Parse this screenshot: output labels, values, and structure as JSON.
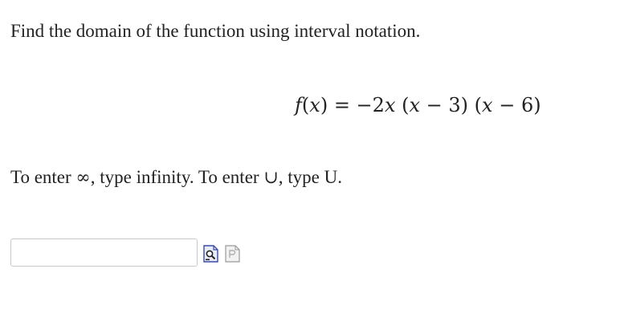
{
  "question": {
    "text": "Find the domain of the function using interval notation."
  },
  "equation": {
    "f": "f",
    "lparen1": "(",
    "x1": "x",
    "rparen1": ")",
    "equals": " = −2",
    "x2": "x",
    "space1": " (",
    "x3": "x",
    "minus3": " − 3) (",
    "x4": "x",
    "minus6": " − 6)"
  },
  "instructions": {
    "part1": "To enter ",
    "infinity_symbol": "∞",
    "part2": ", type infinity. To enter ",
    "union_symbol": "∪",
    "part3": ", type U."
  },
  "answer": {
    "value": "",
    "placeholder": ""
  },
  "icons": {
    "preview": "preview-icon",
    "help": "help-icon",
    "colors": {
      "preview_fill": "#e8ecf7",
      "preview_stroke": "#3a4aa8",
      "help_fill": "#f2f2f2",
      "help_stroke": "#9a9a9a"
    }
  }
}
